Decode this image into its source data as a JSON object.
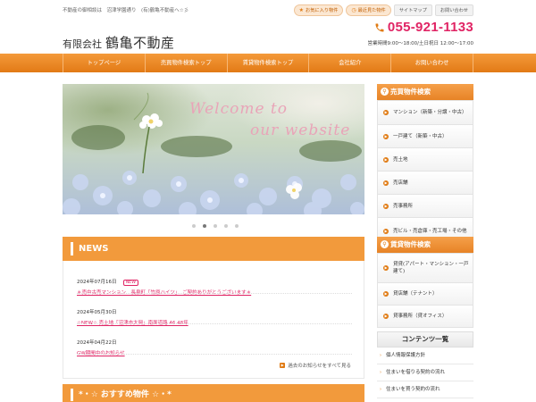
{
  "header": {
    "tagline": "不動産の御相談は　沼津学園通り　(有)鶴亀不動産へ☆彡",
    "top_links": [
      {
        "icon": "star-icon",
        "label": "お気に入り物件"
      },
      {
        "icon": "clock-icon",
        "label": "最近見た物件"
      },
      {
        "label": "サイトマップ"
      },
      {
        "label": "お問い合わせ"
      }
    ],
    "company_prefix": "有限会社",
    "company_name": "鶴亀不動産",
    "phone": "055-921-1133",
    "hours": "営業時間9:00～18:00/土日祝日 12:00～17:00"
  },
  "nav": [
    {
      "label": "トップページ"
    },
    {
      "label": "売買物件検索トップ"
    },
    {
      "label": "賃貸物件検索トップ"
    },
    {
      "label": "会社紹介"
    },
    {
      "label": "お問い合わせ"
    }
  ],
  "hero": {
    "line1": "Welcome to",
    "line2": "our website",
    "slide_count": 5,
    "active_slide": 2
  },
  "news": {
    "title": "NEWS",
    "items": [
      {
        "date": "2024年07月16日",
        "badge": "NEW",
        "text": "＊売中古売マンション　長泉町「竹原ハイツ」　ご契約ありがとうございます＊"
      },
      {
        "date": "2024年05月30日",
        "badge": "",
        "text": "☆NEW☆ 売土地「沼津市大岡」南面道路 46.48坪"
      },
      {
        "date": "2024年04月22日",
        "badge": "",
        "text": "GW期間中のお知らせ"
      }
    ],
    "more_label": "過去のお知らせをすべて見る"
  },
  "recommend": {
    "title": "*・☆ おすすめ物件 ☆・*"
  },
  "sidebar": {
    "sale_title": "売買物件検索",
    "sale_items": [
      {
        "label": "マンション（新築・分譲・中古）"
      },
      {
        "label": "一戸建て（新築・中古）"
      },
      {
        "label": "売土地"
      },
      {
        "label": "売店舗"
      },
      {
        "label": "売事務所"
      },
      {
        "label": "売ビル・売倉庫・売工場・その他"
      }
    ],
    "rent_title": "賃貸物件検索",
    "rent_items": [
      {
        "label": "貸貸(アパート・マンション・一戸建て)"
      },
      {
        "label": "貸店舗（テナント）"
      },
      {
        "label": "貸事務所（貸オフィス）"
      }
    ],
    "contents_title": "コンテンツ一覧",
    "contents_items": [
      {
        "label": "個人情報保護方針"
      },
      {
        "label": "住まいを借りる契約の流れ"
      },
      {
        "label": "住まいを買う契約の流れ"
      }
    ]
  },
  "colors": {
    "accent": "#f29a3c",
    "brand_pink": "#e02464",
    "hero_text": "#e9a4b8"
  }
}
